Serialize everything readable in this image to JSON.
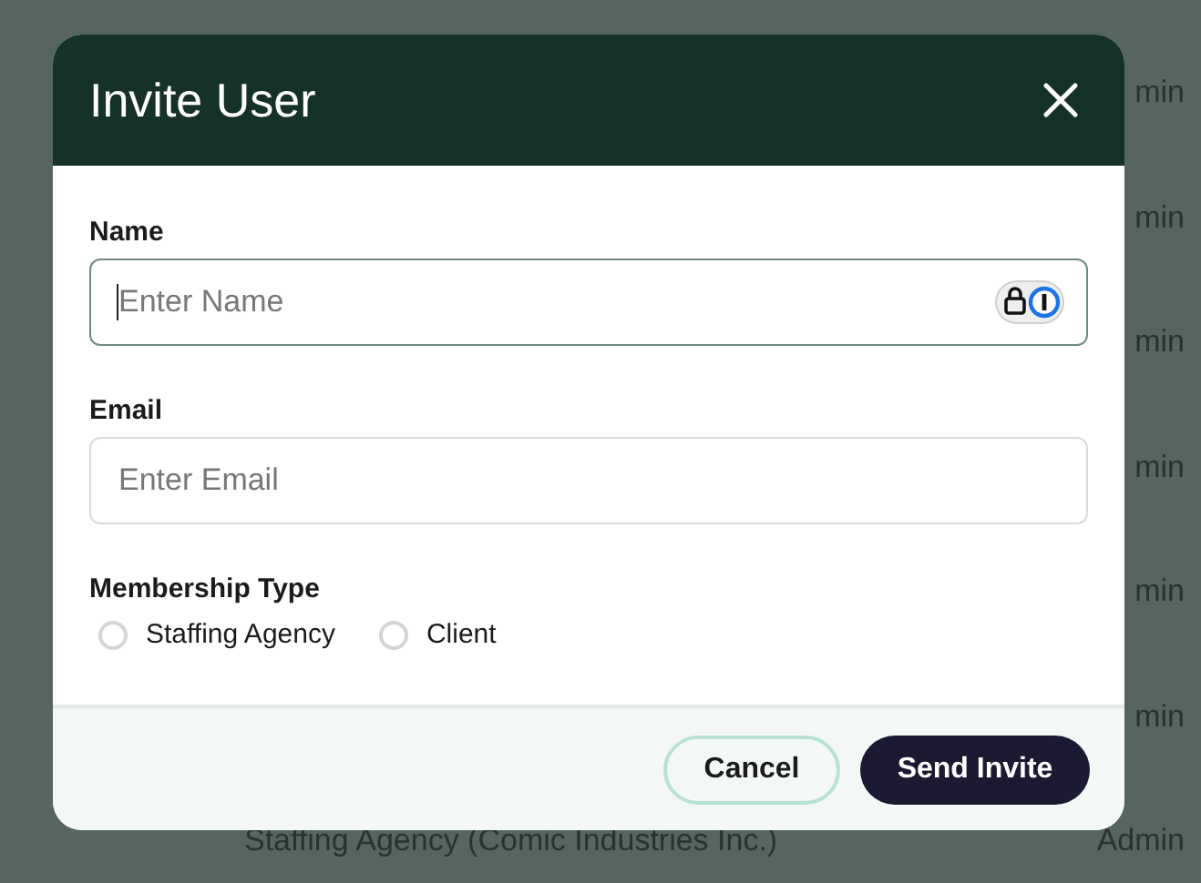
{
  "background_rows": [
    {
      "column_1": "",
      "column_2": "min"
    },
    {
      "column_1": "",
      "column_2": "min"
    },
    {
      "column_1": "",
      "column_2": "min"
    },
    {
      "column_1": "",
      "column_2": "min"
    },
    {
      "column_1": "",
      "column_2": "min"
    },
    {
      "column_1": "",
      "column_2": "min"
    },
    {
      "column_1": "Staffing Agency (Comic Industries Inc.)",
      "column_2": "Admin"
    }
  ],
  "dialog": {
    "title": "Invite User",
    "fields": [
      {
        "label": "Name",
        "placeholder": "Enter Name",
        "focused": true,
        "password_manager": true
      },
      {
        "label": "Email",
        "placeholder": "Enter Email",
        "focused": false,
        "password_manager": false
      }
    ],
    "membership": {
      "label": "Membership Type",
      "options": [
        {
          "label": "Staffing Agency",
          "selected": false
        },
        {
          "label": "Client",
          "selected": false
        }
      ]
    },
    "buttons": [
      {
        "label": "Cancel",
        "kind": "secondary"
      },
      {
        "label": "Send Invite",
        "kind": "primary"
      }
    ]
  }
}
